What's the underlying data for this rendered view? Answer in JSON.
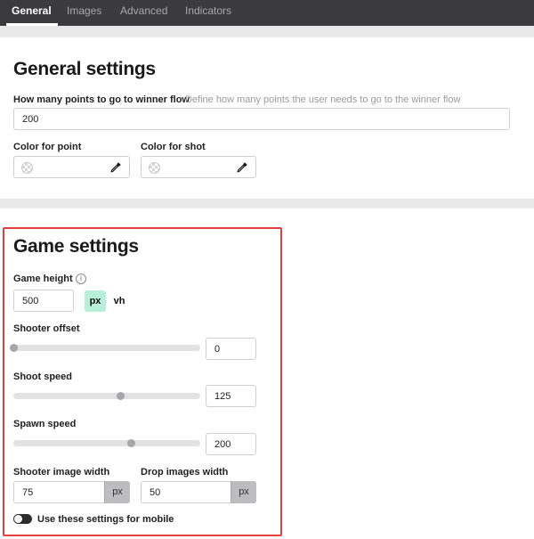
{
  "tabs": [
    {
      "label": "General",
      "active": true
    },
    {
      "label": "Images",
      "active": false
    },
    {
      "label": "Advanced",
      "active": false
    },
    {
      "label": "Indicators",
      "active": false
    }
  ],
  "general": {
    "title": "General settings",
    "points_label": "How many points to go to winner flow",
    "points_hint": "Define how many points the user needs to go to the winner flow",
    "points_value": "200",
    "color_point_label": "Color for point",
    "color_shot_label": "Color for shot"
  },
  "game": {
    "title": "Game settings",
    "height_label": "Game height",
    "height_value": "500",
    "unit_px": "px",
    "unit_vh": "vh",
    "shooter_offset_label": "Shooter offset",
    "shooter_offset_value": "0",
    "shooter_offset_slider": 0.0,
    "shoot_speed_label": "Shoot speed",
    "shoot_speed_value": "125",
    "shoot_speed_slider": 0.57,
    "spawn_speed_label": "Spawn speed",
    "spawn_speed_value": "200",
    "spawn_speed_slider": 0.63,
    "shooter_width_label": "Shooter image width",
    "shooter_width_value": "75",
    "shooter_width_suffix": "px",
    "drop_width_label": "Drop images width",
    "drop_width_value": "50",
    "drop_width_suffix": "px",
    "mobile_toggle_label": "Use these settings for mobile",
    "mobile_toggle_on": false
  },
  "colors": {
    "highlight": "#e2413b",
    "tabbar": "#3b3b3e",
    "px_accent": "#b9eedb"
  }
}
